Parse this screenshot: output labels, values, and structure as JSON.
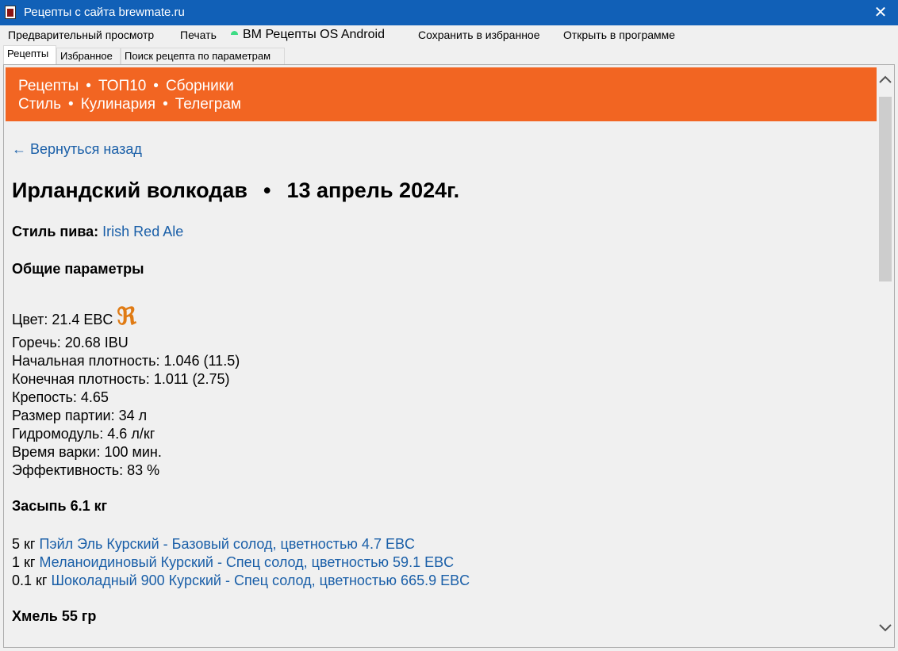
{
  "window": {
    "title": "Рецепты с сайта brewmate.ru",
    "close_glyph": "✕"
  },
  "menu": {
    "preview": "Предварительный просмотр",
    "print": "Печать",
    "android": "BM Рецепты OS Android",
    "save_fav": "Сохранить в избранное",
    "open_program": "Открыть в программе"
  },
  "tabs": [
    "Рецепты",
    "Избранное",
    "Поиск рецепта по параметрам"
  ],
  "banner": {
    "bg_color": "#f26522",
    "row1": [
      "Рецепты",
      "ТОП10",
      "Сборники"
    ],
    "row2": [
      "Стиль",
      "Кулинария",
      "Телеграм"
    ],
    "separator": "•"
  },
  "page": {
    "back": "← Вернуться назад",
    "recipe_name": "Ирландский волкодав",
    "date_sep": "•",
    "date": "13 апрель 2024г.",
    "style_label": "Стиль пива:",
    "style_value": "Irish Red Ale",
    "params_heading": "Общие параметры",
    "color_label": "Цвет: 21.4 EBC",
    "color_icon": "ℜ",
    "params": [
      "Горечь: 20.68 IBU",
      "Начальная плотность: 1.046 (11.5)",
      "Конечная плотность: 1.011 (2.75)",
      "Крепость: 4.65",
      "Размер партии: 34 л",
      "Гидромодуль: 4.6 л/кг",
      "Время варки: 100 мин.",
      "Эффективность: 83 %"
    ],
    "malt_heading": "Засыпь 6.1 кг",
    "malts": [
      {
        "qty": "5 кг",
        "name": "Пэйл Эль Курский - Базовый солод, цветностью 4.7 EBC"
      },
      {
        "qty": "1 кг",
        "name": "Меланоидиновый Курский - Спец солод, цветностью 59.1 EBC"
      },
      {
        "qty": "0.1 кг",
        "name": "Шоколадный 900 Курский - Спец солод, цветностью 665.9 EBC"
      }
    ],
    "hops_heading": "Хмель 55 гр"
  }
}
